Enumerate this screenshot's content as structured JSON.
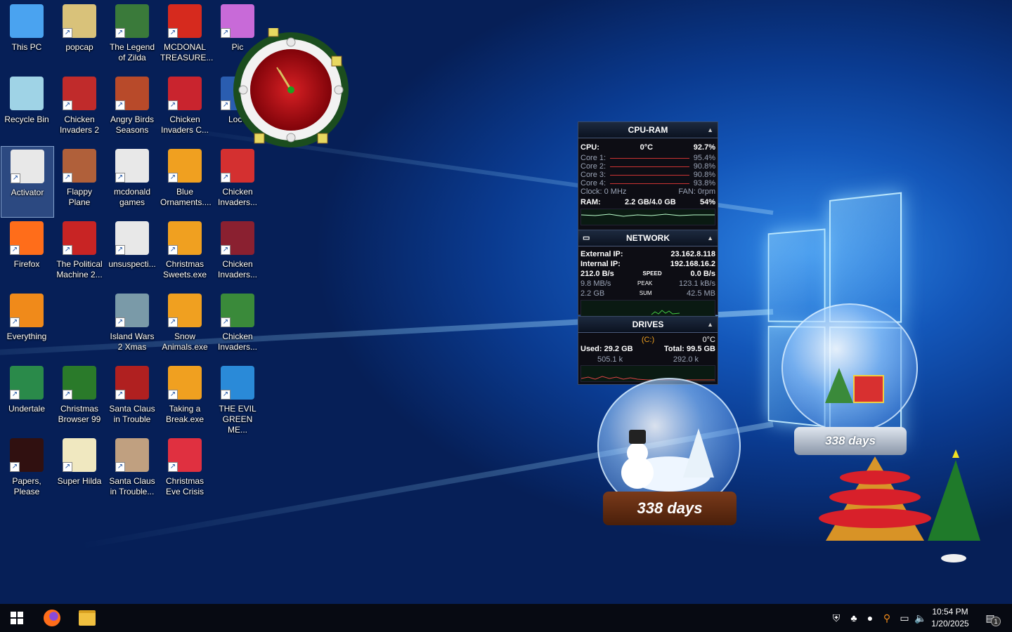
{
  "desktop": {
    "icons": [
      {
        "label": "This PC",
        "icon": "computer-icon",
        "color": "#4aa3f0"
      },
      {
        "label": "popcap",
        "icon": "folder-icon",
        "color": "#d9c27a"
      },
      {
        "label": "The Legend of Zilda",
        "icon": "game-icon",
        "color": "#3a7a3a"
      },
      {
        "label": "MCDONAL TREASURE...",
        "icon": "mcdonalds-icon",
        "color": "#d62a1e"
      },
      {
        "label": "Pic",
        "icon": "game-icon",
        "color": "#c86ad8"
      },
      {
        "label": "Recycle Bin",
        "icon": "recycle-bin-icon",
        "color": "#9fd3e6"
      },
      {
        "label": "Chicken Invaders 2",
        "icon": "chicken-icon",
        "color": "#c02b2b"
      },
      {
        "label": "Angry Birds Seasons",
        "icon": "angry-birds-icon",
        "color": "#b84a2a"
      },
      {
        "label": "Chicken Invaders C...",
        "icon": "chicken-icon",
        "color": "#c9242e"
      },
      {
        "label": "Loco",
        "icon": "game-icon",
        "color": "#2a5db0"
      },
      {
        "label": "Activator",
        "icon": "file-icon",
        "color": "#e8e8e8"
      },
      {
        "label": "Flappy Plane",
        "icon": "game-icon",
        "color": "#b0603a"
      },
      {
        "label": "mcdonald games",
        "icon": "file-icon",
        "color": "#e8e8e8"
      },
      {
        "label": "Blue Ornaments....",
        "icon": "popcap-icon",
        "color": "#f0a020"
      },
      {
        "label": "Chicken Invaders...",
        "icon": "chicken-icon",
        "color": "#d43030"
      },
      {
        "label": "Firefox",
        "icon": "firefox-icon",
        "color": "#ff6d1a"
      },
      {
        "label": "The Political Machine 2...",
        "icon": "game-icon",
        "color": "#c82424"
      },
      {
        "label": "unsuspecti...",
        "icon": "file-icon",
        "color": "#e8e8e8"
      },
      {
        "label": "Christmas Sweets.exe",
        "icon": "popcap-icon",
        "color": "#f0a020"
      },
      {
        "label": "Chicken Invaders...",
        "icon": "chicken-icon",
        "color": "#8a2030"
      },
      {
        "label": "Everything",
        "icon": "search-icon",
        "color": "#f08a1a"
      },
      {
        "label": "Island Wars 2 Xmas",
        "icon": "game-icon",
        "color": "#7a9aa8"
      },
      {
        "label": "Snow Animals.exe",
        "icon": "popcap-icon",
        "color": "#f0a020"
      },
      {
        "label": "Chicken Invaders...",
        "icon": "chicken-icon",
        "color": "#3a8a3a"
      },
      {
        "label": "Undertale",
        "icon": "undertale-icon",
        "color": "#2a8a4a"
      },
      {
        "label": "Christmas Browser 99",
        "icon": "tree-icon",
        "color": "#2a7a2a"
      },
      {
        "label": "Santa Claus in Trouble",
        "icon": "santa-icon",
        "color": "#b02020"
      },
      {
        "label": "Taking a Break.exe",
        "icon": "popcap-icon",
        "color": "#f0a020"
      },
      {
        "label": "THE EVIL GREEN ME...",
        "icon": "messenger-icon",
        "color": "#2a8ad8"
      },
      {
        "label": "Papers, Please",
        "icon": "papers-please-icon",
        "color": "#301010"
      },
      {
        "label": "Super Hilda",
        "icon": "game-icon",
        "color": "#f0e8c0"
      },
      {
        "label": "Santa Claus in Trouble...",
        "icon": "santa-icon",
        "color": "#c0a080"
      },
      {
        "label": "Christmas Eve Crisis",
        "icon": "santa-icon",
        "color": "#e03040"
      }
    ]
  },
  "cpu_ram": {
    "title": "CPU-RAM",
    "cpu_label": "CPU:",
    "cpu_temp": "0°C",
    "cpu_pct": "92.7%",
    "cores": [
      {
        "label": "Core 1:",
        "value": "95.4%"
      },
      {
        "label": "Core 2:",
        "value": "90.8%"
      },
      {
        "label": "Core 3:",
        "value": "90.8%"
      },
      {
        "label": "Core 4:",
        "value": "93.8%"
      }
    ],
    "clock": "Clock: 0 MHz",
    "fan": "FAN: 0rpm",
    "ram_label": "RAM:",
    "ram_value": "2.2 GB/4.0 GB",
    "ram_pct": "54%"
  },
  "network": {
    "title": "NETWORK",
    "external_label": "External IP:",
    "external_ip": "23.162.8.118",
    "internal_label": "Internal IP:",
    "internal_ip": "192.168.16.2",
    "speed_down": "212.0 B/s",
    "speed_label": "SPEED",
    "speed_up": "0.0 B/s",
    "peak_down": "9.8 MB/s",
    "peak_label": "PEAK",
    "peak_up": "123.1 kB/s",
    "sum_down": "2.2 GB",
    "sum_label": "SUM",
    "sum_up": "42.5 MB"
  },
  "drives": {
    "title": "DRIVES",
    "drive": "(C:)",
    "temp": "0°C",
    "used": "Used: 29.2 GB",
    "total": "Total: 99.5 GB",
    "read": "505.1 k",
    "write": "292.0 k"
  },
  "countdowns": {
    "globe1": "338 days",
    "globe2": "338 days"
  },
  "taskbar": {
    "time": "10:54 PM",
    "date": "1/20/2025",
    "notification_count": "1"
  },
  "colors": {
    "taskbar_bg": "#070a12",
    "accent": "#1356b9"
  }
}
